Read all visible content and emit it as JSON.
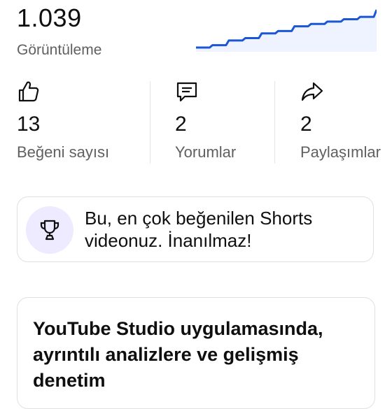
{
  "views": {
    "count": "1.039",
    "label": "Görüntüleme"
  },
  "sparkline": {
    "values": [
      0,
      1,
      3,
      4,
      6,
      7,
      9,
      10,
      11,
      12,
      13,
      16
    ]
  },
  "stats": [
    {
      "icon": "thumbs-up-icon",
      "value": "13",
      "label": "Beğeni sayısı"
    },
    {
      "icon": "comment-icon",
      "value": "2",
      "label": "Yorumlar"
    },
    {
      "icon": "share-icon",
      "value": "2",
      "label": "Paylaşımlar"
    }
  ],
  "achievement": {
    "icon": "trophy-icon",
    "text": "Bu, en çok beğenilen Shorts videonuz. İnanılmaz!"
  },
  "promo": {
    "text": "YouTube Studio uygulamasında, ayrıntılı analizlere ve gelişmiş denetim"
  },
  "colors": {
    "accent": "#1a56d6",
    "icon_circle": "#eeeaff",
    "border": "#e0e0e0"
  }
}
